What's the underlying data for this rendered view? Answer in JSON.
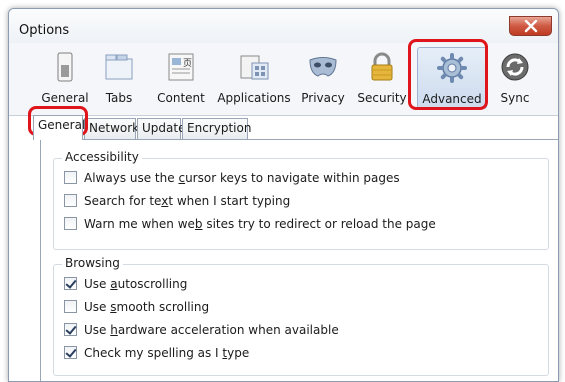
{
  "window": {
    "title": "Options"
  },
  "toolbar": {
    "items": [
      {
        "label": "General",
        "icon": "general-switch-icon"
      },
      {
        "label": "Tabs",
        "icon": "tabs-icon"
      },
      {
        "label": "Content",
        "icon": "content-icon"
      },
      {
        "label": "Applications",
        "icon": "applications-icon"
      },
      {
        "label": "Privacy",
        "icon": "privacy-mask-icon"
      },
      {
        "label": "Security",
        "icon": "padlock-icon"
      },
      {
        "label": "Advanced",
        "icon": "gear-icon"
      },
      {
        "label": "Sync",
        "icon": "sync-icon"
      }
    ],
    "selected": "Advanced"
  },
  "tabs": [
    "General",
    "Network",
    "Update",
    "Encryption"
  ],
  "accessibility": {
    "title": "Accessibility",
    "options": [
      {
        "pre": "Always use the ",
        "u": "c",
        "post": "ursor keys to navigate within pages",
        "checked": false
      },
      {
        "pre": "Search for te",
        "u": "x",
        "post": "t when I start typing",
        "checked": false
      },
      {
        "pre": "Warn me when we",
        "u": "b",
        "post": " sites try to redirect or reload the page",
        "checked": false
      }
    ]
  },
  "browsing": {
    "title": "Browsing",
    "options": [
      {
        "pre": "Use ",
        "u": "a",
        "post": "utoscrolling",
        "checked": true
      },
      {
        "pre": "Use ",
        "u": "s",
        "post": "mooth scrolling",
        "checked": false
      },
      {
        "pre": "Use ",
        "u": "h",
        "post": "ardware acceleration when available",
        "checked": true
      },
      {
        "pre": "Check my spelling as I ",
        "u": "t",
        "post": "ype",
        "checked": true
      }
    ]
  },
  "colors": {
    "highlight": "#e0141b",
    "selected_bg": "#cddbee"
  }
}
